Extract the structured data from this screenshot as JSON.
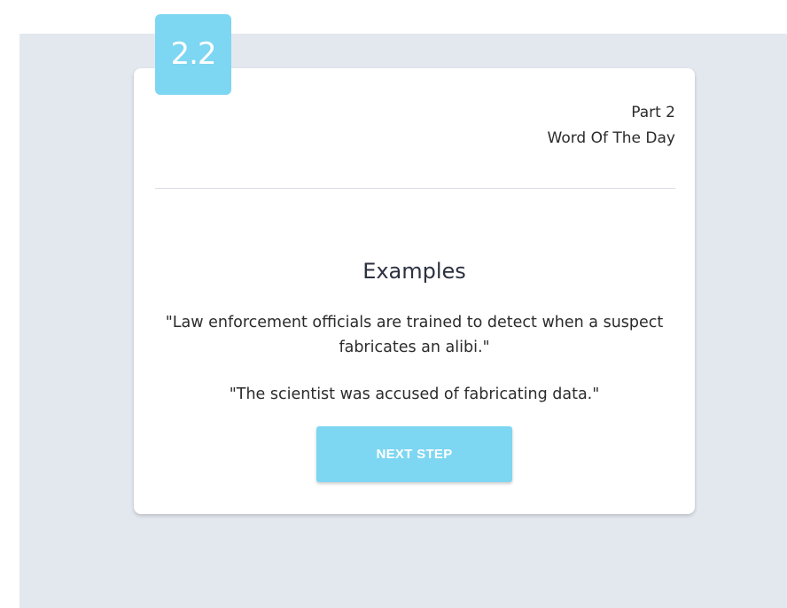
{
  "step": {
    "badge": "2.2"
  },
  "header": {
    "part": "Part 2",
    "title": "Word Of The Day"
  },
  "content": {
    "section_title": "Examples",
    "examples": [
      "\"Law enforcement officials are trained to detect when a suspect fabricates an alibi.\"",
      "\"The scientist was accused of fabricating data.\""
    ]
  },
  "actions": {
    "next_label": "NEXT STEP"
  },
  "colors": {
    "accent": "#7dd6f2",
    "background": "#e3e8ef",
    "card": "#ffffff"
  }
}
